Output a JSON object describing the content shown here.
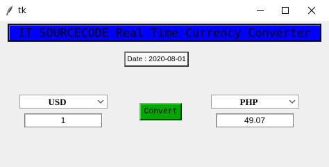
{
  "window": {
    "title": "tk",
    "icon": "feather-icon",
    "controls": [
      "minimize-icon",
      "maximize-icon",
      "close-icon"
    ]
  },
  "banner": {
    "text": "IT SOURCECODE Real Time Currency Converter",
    "background": "#0000fe"
  },
  "date_label": "Date : 2020-08-01",
  "from": {
    "currency": "USD",
    "amount": "1"
  },
  "to": {
    "currency": "PHP",
    "amount": "49.07"
  },
  "convert": {
    "label": "Convert",
    "background": "#00a800"
  }
}
